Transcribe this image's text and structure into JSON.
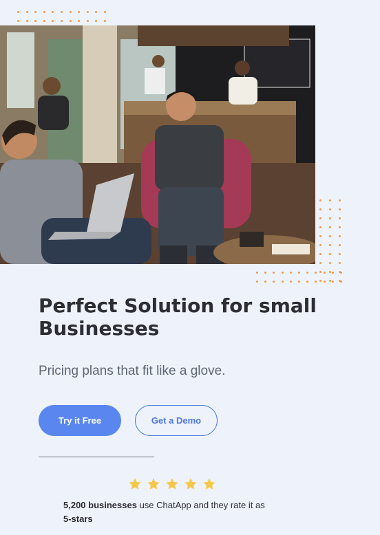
{
  "hero": {
    "image_alt": "Two men chatting with a laptop in a cafe",
    "title": "Perfect Solution for small Businesses",
    "subtitle": "Pricing plans that fit like a glove."
  },
  "buttons": {
    "primary_label": "Try it Free",
    "secondary_label": "Get a Demo"
  },
  "rating": {
    "stars": 5,
    "count_text": "5,200 businesses",
    "middle_text": " use ChatApp and they rate it as ",
    "rating_text": "5-stars"
  },
  "colors": {
    "accent": "#5a86f0",
    "dots": "#ef9a4a",
    "star": "#f5c84c",
    "background": "#eef2fb"
  },
  "icons": [
    "star-icon"
  ]
}
